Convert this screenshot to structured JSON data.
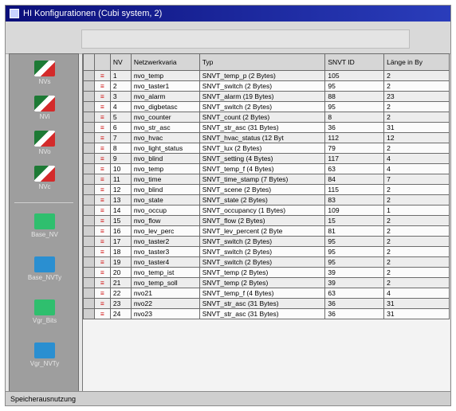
{
  "window": {
    "title": "HI Konfigurationen (Cubi system, 2)"
  },
  "sidebar": {
    "buttons": [
      {
        "label": "NVs",
        "icon": "flag-icon"
      },
      {
        "label": "NVi",
        "icon": "flag-icon"
      },
      {
        "label": "NVo",
        "icon": "flag-icon"
      },
      {
        "label": "NVc",
        "icon": "flag-icon"
      },
      {
        "label": "Base_NV",
        "icon": "green-square-icon"
      },
      {
        "label": "Base_NVTy",
        "icon": "blue-square-icon"
      },
      {
        "label": "Vgr_Bits",
        "icon": "green-square-icon"
      },
      {
        "label": "Vgr_NVTy",
        "icon": "blue-square-icon"
      }
    ]
  },
  "table": {
    "headers": [
      "NV",
      "Netzwerkvaria",
      "Typ",
      "SNVT ID",
      "Länge in By"
    ],
    "rows": [
      [
        "1",
        "nvo_temp",
        "SNVT_temp_p (2 Bytes)",
        "105",
        "2"
      ],
      [
        "2",
        "nvo_taster1",
        "SNVT_switch (2 Bytes)",
        "95",
        "2"
      ],
      [
        "3",
        "nvo_alarm",
        "SNVT_alarm (19 Bytes)",
        "88",
        "23"
      ],
      [
        "4",
        "nvo_digbetasc",
        "SNVT_switch (2 Bytes)",
        "95",
        "2"
      ],
      [
        "5",
        "nvo_counter",
        "SNVT_count (2 Bytes)",
        "8",
        "2"
      ],
      [
        "6",
        "nvo_str_asc",
        "SNVT_str_asc (31 Bytes)",
        "36",
        "31"
      ],
      [
        "7",
        "nvo_hvac",
        "SNVT_hvac_status (12 Byt",
        "112",
        "12"
      ],
      [
        "8",
        "nvo_light_status",
        "SNVT_lux (2 Bytes)",
        "79",
        "2"
      ],
      [
        "9",
        "nvo_blind",
        "SNVT_setting (4 Bytes)",
        "117",
        "4"
      ],
      [
        "10",
        "nvo_temp",
        "SNVT_temp_f (4 Bytes)",
        "63",
        "4"
      ],
      [
        "11",
        "nvo_time",
        "SNVT_time_stamp (7 Bytes)",
        "84",
        "7"
      ],
      [
        "12",
        "nvo_blind",
        "SNVT_scene (2 Bytes)",
        "115",
        "2"
      ],
      [
        "13",
        "nvo_state",
        "SNVT_state (2 Bytes)",
        "83",
        "2"
      ],
      [
        "14",
        "nvo_occup",
        "SNVT_occupancy (1 Bytes)",
        "109",
        "1"
      ],
      [
        "15",
        "nvo_flow",
        "SNVT_flow (2 Bytes)",
        "15",
        "2"
      ],
      [
        "16",
        "nvo_lev_perc",
        "SNVT_lev_percent (2 Byte",
        "81",
        "2"
      ],
      [
        "17",
        "nvo_taster2",
        "SNVT_switch (2 Bytes)",
        "95",
        "2"
      ],
      [
        "18",
        "nvo_taster3",
        "SNVT_switch (2 Bytes)",
        "95",
        "2"
      ],
      [
        "19",
        "nvo_taster4",
        "SNVT_switch (2 Bytes)",
        "95",
        "2"
      ],
      [
        "20",
        "nvo_temp_ist",
        "SNVT_temp (2 Bytes)",
        "39",
        "2"
      ],
      [
        "21",
        "nvo_temp_soll",
        "SNVT_temp (2 Bytes)",
        "39",
        "2"
      ],
      [
        "22",
        "nvo21",
        "SNVT_temp_f (4 Bytes)",
        "63",
        "4"
      ],
      [
        "23",
        "nvo22",
        "SNVT_str_asc (31 Bytes)",
        "36",
        "31"
      ],
      [
        "24",
        "nvo23",
        "SNVT_str_asc (31 Bytes)",
        "36",
        "31"
      ]
    ]
  },
  "statusbar": {
    "text": "Speicherausnutzung"
  }
}
